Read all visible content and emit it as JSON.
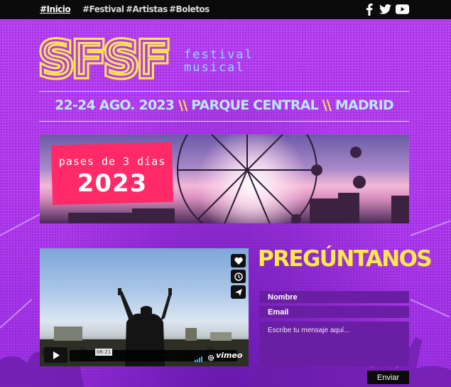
{
  "nav": {
    "links": [
      "#Inicio",
      "#Festival",
      "#Artistas",
      "#Boletos"
    ]
  },
  "social": {
    "icons": [
      "facebook-icon",
      "twitter-icon",
      "youtube-icon"
    ]
  },
  "logo": {
    "mark": "SFSF",
    "sub_line1": "festival",
    "sub_line2": "musical"
  },
  "event": {
    "dates": "22-24 AGO. 2023",
    "separator": "\\\\",
    "venue": "PARQUE CENTRAL",
    "city": "MADRID"
  },
  "banner": {
    "label": "pases de 3 días",
    "year": "2023"
  },
  "video": {
    "time": "06:21",
    "brand": "vimeo"
  },
  "contact": {
    "title": "PREGÚNTANOS",
    "name_placeholder": "Nombre",
    "email_placeholder": "Email",
    "message_placeholder": "Escribe tu mensaje aquí...",
    "submit_label": "Enviar"
  },
  "colors": {
    "background": "#b43df0",
    "accent_yellow": "#ffe84a",
    "accent_blue": "#bde6ff",
    "pink": "#ff2a67",
    "field": "#6a1ea3"
  }
}
